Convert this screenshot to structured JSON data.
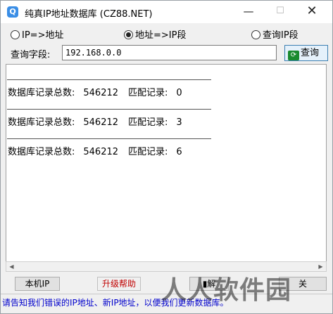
{
  "window": {
    "title": "纯真IP地址数据库  (CZ88.NET)",
    "minimize": "—",
    "maximize": "☐",
    "close": "✕"
  },
  "mode": {
    "option1": "IP=>地址",
    "option2": "地址=>IP段",
    "option3": "查询IP段",
    "selected": "option2"
  },
  "query": {
    "label": "查询字段:",
    "value": "192.168.0.0",
    "button": "查询"
  },
  "results": [
    {
      "total_label": "数据库记录总数:",
      "total": "546212",
      "match_label": "匹配记录:",
      "match": "0"
    },
    {
      "total_label": "数据库记录总数:",
      "total": "546212",
      "match_label": "匹配记录:",
      "match": "3"
    },
    {
      "total_label": "数据库记录总数:",
      "total": "546212",
      "match_label": "匹配记录:",
      "match": "6"
    }
  ],
  "buttons": {
    "local_ip": "本机IP",
    "upgrade_help": "升级帮助",
    "explain": "解",
    "close": "关"
  },
  "status": "请告知我们错误的IP地址、新IP地址，以便我们更新数据库。",
  "watermark": "人人软件园"
}
